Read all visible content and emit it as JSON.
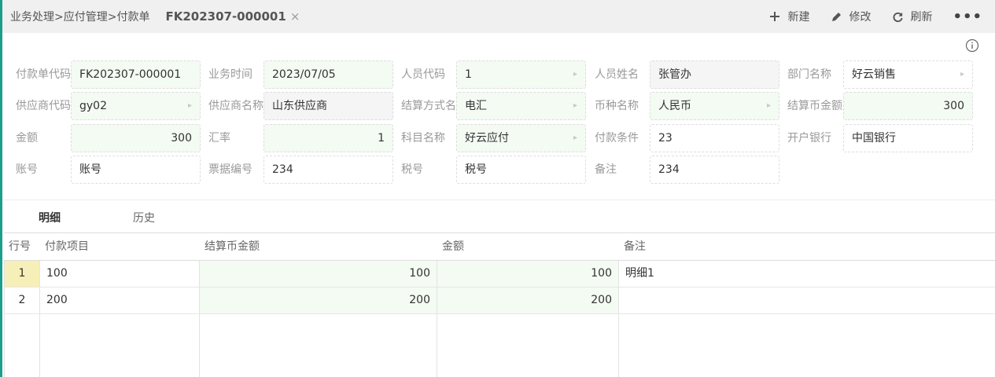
{
  "header": {
    "breadcrumb": "业务处理>应付管理>付款单",
    "doc_tab": "FK202307-000001",
    "close_glyph": "×",
    "actions": [
      {
        "label": "新建",
        "icon": "plus-icon"
      },
      {
        "label": "修改",
        "icon": "pencil-icon"
      },
      {
        "label": "刷新",
        "icon": "refresh-icon"
      }
    ],
    "more_glyph": "•••"
  },
  "form": {
    "payment_code": {
      "label": "付款单代码",
      "value": "FK202307-000001"
    },
    "business_time": {
      "label": "业务时间",
      "value": "2023/07/05"
    },
    "staff_code": {
      "label": "人员代码",
      "value": "1"
    },
    "staff_name": {
      "label": "人员姓名",
      "value": "张管办"
    },
    "department": {
      "label": "部门名称",
      "value": "好云销售"
    },
    "supplier_code": {
      "label": "供应商代码",
      "value": "gy02"
    },
    "supplier_name": {
      "label": "供应商名称",
      "value": "山东供应商"
    },
    "settlement_method": {
      "label": "结算方式名",
      "value": "电汇"
    },
    "currency": {
      "label": "币种名称",
      "value": "人民币"
    },
    "settlement_amount": {
      "label": "结算币金额",
      "value": "300"
    },
    "amount": {
      "label": "金额",
      "value": "300"
    },
    "exchange_rate": {
      "label": "汇率",
      "value": "1"
    },
    "subject": {
      "label": "科目名称",
      "value": "好云应付"
    },
    "payment_terms": {
      "label": "付款条件",
      "value": "23"
    },
    "bank": {
      "label": "开户银行",
      "value": "中国银行"
    },
    "account": {
      "label": "账号",
      "value": "账号"
    },
    "bill_no": {
      "label": "票据编号",
      "value": "234"
    },
    "tax_no": {
      "label": "税号",
      "value": "税号"
    },
    "remark": {
      "label": "备注",
      "value": "234"
    }
  },
  "tabs": [
    {
      "label": "明细",
      "active": true
    },
    {
      "label": "历史",
      "active": false
    }
  ],
  "grid": {
    "columns": [
      "行号",
      "付款项目",
      "结算币金额",
      "金额",
      "备注"
    ],
    "rows": [
      [
        "1",
        "100",
        "100",
        "100",
        "明细1"
      ],
      [
        "2",
        "200",
        "200",
        "200",
        ""
      ]
    ]
  },
  "colors": {
    "accent": "#1b9e8c",
    "editable_bg": "#f3fbf3",
    "readonly_bg": "#f5f5f5",
    "selected_row_num": "#f6f0b8"
  }
}
